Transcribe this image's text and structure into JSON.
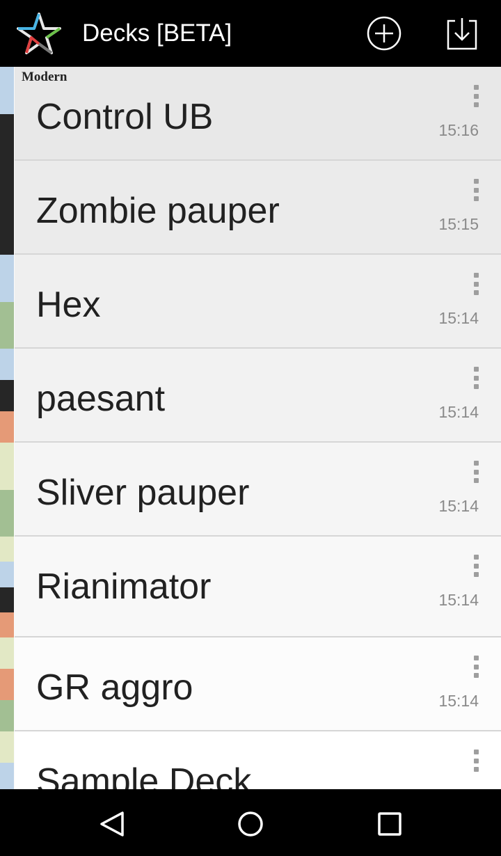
{
  "appbar": {
    "title": "Decks [BETA]",
    "add_icon": "add-circle-icon",
    "download_icon": "download-icon"
  },
  "colors": {
    "blue": "#bdd3e8",
    "black": "#262626",
    "green": "#a2bf93",
    "red": "#e59a77",
    "white": "#e2e8c5"
  },
  "decks": [
    {
      "format": "Modern",
      "name": "Control UB",
      "time": "15:16",
      "colors": [
        "blue",
        "black"
      ]
    },
    {
      "format": "",
      "name": "Zombie pauper",
      "time": "15:15",
      "colors": [
        "black"
      ]
    },
    {
      "format": "",
      "name": "Hex",
      "time": "15:14",
      "colors": [
        "blue",
        "green"
      ]
    },
    {
      "format": "",
      "name": "paesant",
      "time": "15:14",
      "colors": [
        "blue",
        "black",
        "red"
      ]
    },
    {
      "format": "",
      "name": "Sliver pauper",
      "time": "15:14",
      "colors": [
        "white",
        "green"
      ]
    },
    {
      "format": "",
      "name": "Rianimator",
      "time": "15:14",
      "colors": [
        "white",
        "blue",
        "black",
        "red"
      ]
    },
    {
      "format": "",
      "name": "GR aggro",
      "time": "15:14",
      "colors": [
        "white",
        "red",
        "green"
      ]
    },
    {
      "format": "",
      "name": "Sample Deck",
      "time": "",
      "colors": [
        "white",
        "blue",
        "red"
      ]
    }
  ],
  "navbar": {
    "back_icon": "back-icon",
    "home_icon": "home-icon",
    "recents_icon": "recents-icon"
  }
}
